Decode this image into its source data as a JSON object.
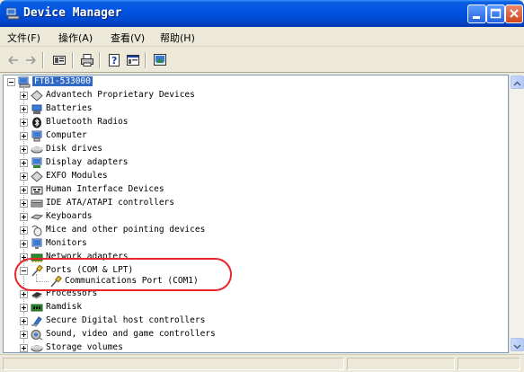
{
  "window": {
    "title": "Device Manager",
    "accent": "#0054e3"
  },
  "menu": {
    "items": [
      {
        "label": "文件(F)"
      },
      {
        "label": "操作(A)"
      },
      {
        "label": "查看(V)"
      },
      {
        "label": "帮助(H)"
      }
    ]
  },
  "toolbar": {
    "items": [
      "back-arrow-icon",
      "forward-arrow-icon",
      "properties-icon",
      "print-icon",
      "help-icon",
      "console-tree-icon",
      "scan-hardware-icon"
    ]
  },
  "tree": {
    "root": {
      "label": "FTB1-533000"
    },
    "items": [
      {
        "label": "Advantech Proprietary Devices",
        "icon": "diamond-device-icon"
      },
      {
        "label": "Batteries",
        "icon": "battery-icon"
      },
      {
        "label": "Bluetooth Radios",
        "icon": "bluetooth-icon"
      },
      {
        "label": "Computer",
        "icon": "computer-icon"
      },
      {
        "label": "Disk drives",
        "icon": "disk-drive-icon"
      },
      {
        "label": "Display adapters",
        "icon": "display-adapter-icon"
      },
      {
        "label": "EXFO Modules",
        "icon": "diamond-device-icon"
      },
      {
        "label": "Human Interface Devices",
        "icon": "hid-icon"
      },
      {
        "label": "IDE ATA/ATAPI controllers",
        "icon": "ide-controller-icon"
      },
      {
        "label": "Keyboards",
        "icon": "keyboard-icon"
      },
      {
        "label": "Mice and other pointing devices",
        "icon": "mouse-icon"
      },
      {
        "label": "Monitors",
        "icon": "monitor-icon"
      },
      {
        "label": "Network adapters",
        "icon": "network-adapter-icon"
      },
      {
        "label": "Ports (COM & LPT)",
        "icon": "port-icon",
        "expanded": true
      },
      {
        "label": "Communications Port (COM1)",
        "icon": "port-icon",
        "child": true
      },
      {
        "label": "Processors",
        "icon": "processor-icon"
      },
      {
        "label": "Ramdisk",
        "icon": "ramdisk-icon"
      },
      {
        "label": "Secure Digital host controllers",
        "icon": "sd-host-icon"
      },
      {
        "label": "Sound, video and game controllers",
        "icon": "sound-icon"
      },
      {
        "label": "Storage volumes",
        "icon": "storage-volume-icon"
      }
    ]
  },
  "annotation": {
    "ring_color": "#e8262b"
  }
}
